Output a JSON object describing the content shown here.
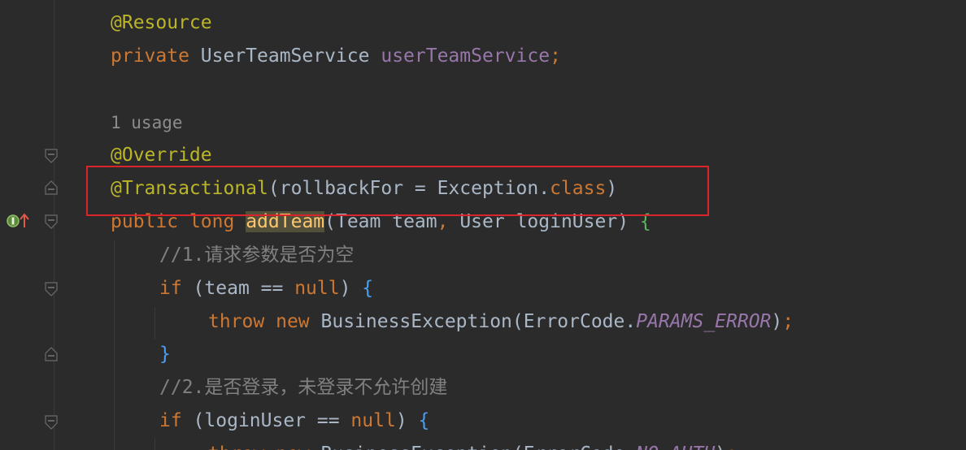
{
  "editor": {
    "lines": [
      {
        "tokens": [
          {
            "t": "@Resource",
            "c": "annot"
          }
        ]
      },
      {
        "tokens": [
          {
            "t": "private",
            "c": "kw"
          },
          {
            "t": " UserTeamService ",
            "c": "plain"
          },
          {
            "t": "userTeamService",
            "c": "field"
          },
          {
            "t": ";",
            "c": "kw"
          }
        ]
      },
      {
        "tokens": []
      },
      {
        "tokens": [
          {
            "t": "1 usage",
            "c": "hint"
          }
        ]
      },
      {
        "tokens": [
          {
            "t": "@Override",
            "c": "annot"
          }
        ]
      },
      {
        "tokens": [
          {
            "t": "@Transactional",
            "c": "annot"
          },
          {
            "t": "(rollbackFor = Exception.",
            "c": "plain"
          },
          {
            "t": "class",
            "c": "kw"
          },
          {
            "t": ")",
            "c": "plain"
          }
        ]
      },
      {
        "tokens": [
          {
            "t": "public",
            "c": "kw"
          },
          {
            "t": " ",
            "c": "plain"
          },
          {
            "t": "long",
            "c": "kw"
          },
          {
            "t": " ",
            "c": "plain"
          },
          {
            "t": "addTeam",
            "c": "method-hl"
          },
          {
            "t": "(Team team",
            "c": "plain"
          },
          {
            "t": ",",
            "c": "kw"
          },
          {
            "t": " User loginUser) ",
            "c": "plain"
          },
          {
            "t": "{",
            "c": "brace-g"
          }
        ]
      },
      {
        "tokens": [
          {
            "t": "//1.请求参数是否为空",
            "c": "comment"
          }
        ]
      },
      {
        "tokens": [
          {
            "t": "if",
            "c": "kw"
          },
          {
            "t": " (team == ",
            "c": "plain"
          },
          {
            "t": "null",
            "c": "kw"
          },
          {
            "t": ") ",
            "c": "plain"
          },
          {
            "t": "{",
            "c": "brace-b"
          }
        ]
      },
      {
        "tokens": [
          {
            "t": "throw",
            "c": "kw"
          },
          {
            "t": " ",
            "c": "plain"
          },
          {
            "t": "new",
            "c": "kw"
          },
          {
            "t": " BusinessException(ErrorCode.",
            "c": "plain"
          },
          {
            "t": "PARAMS_ERROR",
            "c": "const"
          },
          {
            "t": ")",
            "c": "plain"
          },
          {
            "t": ";",
            "c": "kw"
          }
        ]
      },
      {
        "tokens": [
          {
            "t": "}",
            "c": "brace-b"
          }
        ]
      },
      {
        "tokens": [
          {
            "t": "//2.是否登录，未登录不允许创建",
            "c": "comment"
          }
        ]
      },
      {
        "tokens": [
          {
            "t": "if",
            "c": "kw"
          },
          {
            "t": " (loginUser == ",
            "c": "plain"
          },
          {
            "t": "null",
            "c": "kw"
          },
          {
            "t": ") ",
            "c": "plain"
          },
          {
            "t": "{",
            "c": "brace-b"
          }
        ]
      },
      {
        "tokens": [
          {
            "t": "throw",
            "c": "kw"
          },
          {
            "t": " ",
            "c": "plain"
          },
          {
            "t": "new",
            "c": "kw"
          },
          {
            "t": " BusinessException(ErrorCode.",
            "c": "plain"
          },
          {
            "t": "NO_AUTH",
            "c": "const"
          },
          {
            "t": ")",
            "c": "plain"
          },
          {
            "t": ";",
            "c": "kw"
          }
        ]
      }
    ]
  },
  "gutter": {
    "implements_icon": "implements-interface-icon",
    "override_icon": "override-arrow-icon",
    "fold_icon": "fold-marker-icon"
  },
  "colors": {
    "background": "#2b2b2b",
    "annotation": "#bbb529",
    "keyword": "#cc7832",
    "field": "#9876aa",
    "text": "#a9b7c6",
    "comment": "#808080",
    "highlight_box": "#d9242b"
  }
}
